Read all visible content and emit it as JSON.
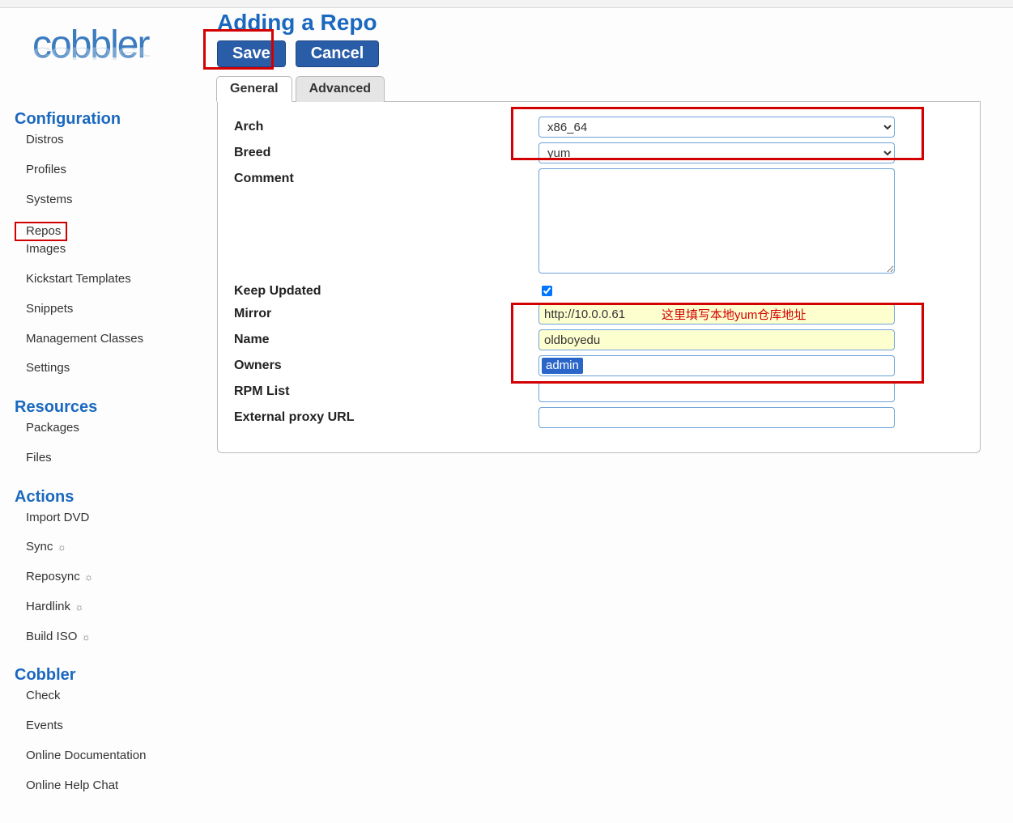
{
  "logo_text": "cobbler",
  "page_title": "Adding a Repo",
  "buttons": {
    "save": "Save",
    "cancel": "Cancel"
  },
  "tabs": {
    "general": "General",
    "advanced": "Advanced"
  },
  "sidebar": {
    "sections": [
      {
        "title": "Configuration",
        "items": [
          {
            "label": "Distros",
            "key": "distros"
          },
          {
            "label": "Profiles",
            "key": "profiles"
          },
          {
            "label": "Systems",
            "key": "systems"
          },
          {
            "label": "Repos",
            "key": "repos",
            "highlighted": true
          },
          {
            "label": "Images",
            "key": "images"
          },
          {
            "label": "Kickstart Templates",
            "key": "kickstart-templates"
          },
          {
            "label": "Snippets",
            "key": "snippets"
          },
          {
            "label": "Management Classes",
            "key": "management-classes"
          },
          {
            "label": "Settings",
            "key": "settings"
          }
        ]
      },
      {
        "title": "Resources",
        "items": [
          {
            "label": "Packages",
            "key": "packages"
          },
          {
            "label": "Files",
            "key": "files"
          }
        ]
      },
      {
        "title": "Actions",
        "items": [
          {
            "label": "Import DVD",
            "key": "import-dvd"
          },
          {
            "label": "Sync",
            "key": "sync",
            "gear": true
          },
          {
            "label": "Reposync",
            "key": "reposync",
            "gear": true
          },
          {
            "label": "Hardlink",
            "key": "hardlink",
            "gear": true
          },
          {
            "label": "Build ISO",
            "key": "build-iso",
            "gear": true
          }
        ]
      },
      {
        "title": "Cobbler",
        "items": [
          {
            "label": "Check",
            "key": "check"
          },
          {
            "label": "Events",
            "key": "events"
          },
          {
            "label": "Online Documentation",
            "key": "online-documentation"
          },
          {
            "label": "Online Help Chat",
            "key": "online-help-chat"
          }
        ]
      }
    ]
  },
  "form": {
    "arch": {
      "label": "Arch",
      "value": "x86_64"
    },
    "breed": {
      "label": "Breed",
      "value": "yum"
    },
    "comment": {
      "label": "Comment",
      "value": ""
    },
    "keep_updated": {
      "label": "Keep Updated",
      "checked": true
    },
    "mirror": {
      "label": "Mirror",
      "value": "http://10.0.0.61"
    },
    "name": {
      "label": "Name",
      "value": "oldboyedu"
    },
    "owners": {
      "label": "Owners",
      "value": "admin"
    },
    "rpm_list": {
      "label": "RPM List",
      "value": ""
    },
    "external_proxy_url": {
      "label": "External proxy URL",
      "value": ""
    }
  },
  "annotations": {
    "mirror_note": "这里填写本地yum仓库地址"
  }
}
